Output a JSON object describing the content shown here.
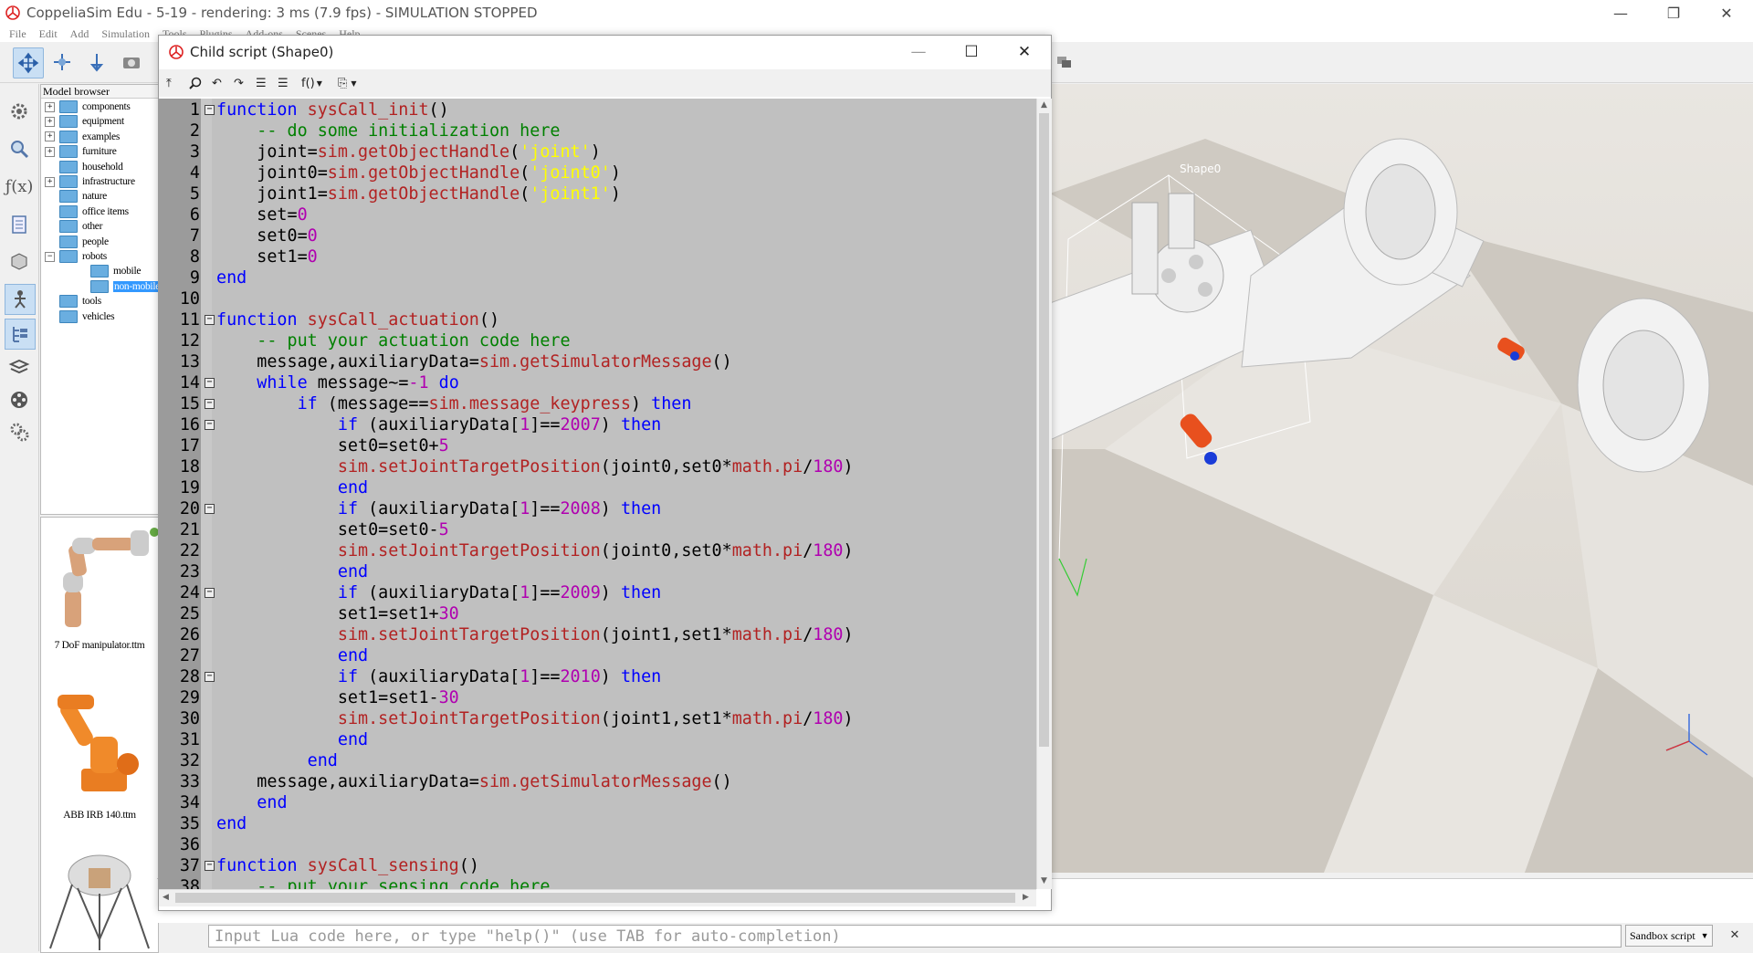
{
  "app": {
    "title": "CoppeliaSim Edu - 5-19 - rendering: 3 ms (7.9 fps) - SIMULATION STOPPED",
    "window_buttons": [
      "—",
      "❐",
      "✕"
    ]
  },
  "menubar": [
    "File",
    "Edit",
    "Add",
    "Simulation",
    "Tools",
    "Plugins",
    "Add-ons",
    "Scenes",
    "Help"
  ],
  "model_browser": {
    "title": "Model browser",
    "items": [
      {
        "label": "components",
        "expand": "+"
      },
      {
        "label": "equipment",
        "expand": "+"
      },
      {
        "label": "examples",
        "expand": "+"
      },
      {
        "label": "furniture",
        "expand": "+"
      },
      {
        "label": "household",
        "expand": ""
      },
      {
        "label": "infrastructure",
        "expand": "+"
      },
      {
        "label": "nature",
        "expand": ""
      },
      {
        "label": "office items",
        "expand": ""
      },
      {
        "label": "other",
        "expand": ""
      },
      {
        "label": "people",
        "expand": ""
      },
      {
        "label": "robots",
        "expand": "−"
      },
      {
        "label": "mobile",
        "expand": ""
      },
      {
        "label": "non-mobile",
        "expand": ""
      },
      {
        "label": "tools",
        "expand": ""
      },
      {
        "label": "vehicles",
        "expand": ""
      }
    ],
    "thumbnails": [
      "7 DoF manipulator.ttm",
      "ABB IRB 140.ttm"
    ]
  },
  "scene": {
    "object_label": "Shape0",
    "colors": {
      "floor_light": "#e8e5e0",
      "floor_dark": "#cbc6be",
      "actuator": "#e8501e",
      "actuator_tip": "#1a3cd8"
    }
  },
  "editor": {
    "title": "Child script (Shape0)",
    "toolbar_func": "f()",
    "lines": [
      {
        "n": "1",
        "fold": "−",
        "t": [
          [
            "kw",
            "function"
          ],
          [
            "pu",
            " "
          ],
          [
            "fn",
            "sysCall_init"
          ],
          [
            "pu",
            "()"
          ]
        ]
      },
      {
        "n": "2",
        "fold": "",
        "t": [
          [
            "pu",
            "    "
          ],
          [
            "cm",
            "-- do some initialization here"
          ]
        ]
      },
      {
        "n": "3",
        "fold": "",
        "t": [
          [
            "pu",
            "    joint="
          ],
          [
            "fn",
            "sim.getObjectHandle"
          ],
          [
            "pu",
            "("
          ],
          [
            "st",
            "'joint'"
          ],
          [
            "pu",
            ")"
          ]
        ]
      },
      {
        "n": "4",
        "fold": "",
        "t": [
          [
            "pu",
            "    joint0="
          ],
          [
            "fn",
            "sim.getObjectHandle"
          ],
          [
            "pu",
            "("
          ],
          [
            "st",
            "'joint0'"
          ],
          [
            "pu",
            ")"
          ]
        ]
      },
      {
        "n": "5",
        "fold": "",
        "t": [
          [
            "pu",
            "    joint1="
          ],
          [
            "fn",
            "sim.getObjectHandle"
          ],
          [
            "pu",
            "("
          ],
          [
            "st",
            "'joint1'"
          ],
          [
            "pu",
            ")"
          ]
        ]
      },
      {
        "n": "6",
        "fold": "",
        "t": [
          [
            "pu",
            "    set="
          ],
          [
            "nm",
            "0"
          ]
        ]
      },
      {
        "n": "7",
        "fold": "",
        "t": [
          [
            "pu",
            "    set0="
          ],
          [
            "nm",
            "0"
          ]
        ]
      },
      {
        "n": "8",
        "fold": "",
        "t": [
          [
            "pu",
            "    set1="
          ],
          [
            "nm",
            "0"
          ]
        ]
      },
      {
        "n": "9",
        "fold": "",
        "t": [
          [
            "kw",
            "end"
          ]
        ]
      },
      {
        "n": "10",
        "fold": "",
        "t": []
      },
      {
        "n": "11",
        "fold": "−",
        "t": [
          [
            "kw",
            "function"
          ],
          [
            "pu",
            " "
          ],
          [
            "fn",
            "sysCall_actuation"
          ],
          [
            "pu",
            "()"
          ]
        ]
      },
      {
        "n": "12",
        "fold": "",
        "t": [
          [
            "pu",
            "    "
          ],
          [
            "cm",
            "-- put your actuation code here"
          ]
        ]
      },
      {
        "n": "13",
        "fold": "",
        "t": [
          [
            "pu",
            "    message,auxiliaryData="
          ],
          [
            "fn",
            "sim.getSimulatorMessage"
          ],
          [
            "pu",
            "()"
          ]
        ]
      },
      {
        "n": "14",
        "fold": "−",
        "t": [
          [
            "pu",
            "    "
          ],
          [
            "kw",
            "while"
          ],
          [
            "pu",
            " message~="
          ],
          [
            "nm",
            "-1"
          ],
          [
            "pu",
            " "
          ],
          [
            "kw",
            "do"
          ]
        ]
      },
      {
        "n": "15",
        "fold": "−",
        "t": [
          [
            "pu",
            "        "
          ],
          [
            "kw",
            "if"
          ],
          [
            "pu",
            " (message=="
          ],
          [
            "fn",
            "sim.message_keypress"
          ],
          [
            "pu",
            ") "
          ],
          [
            "kw",
            "then"
          ]
        ]
      },
      {
        "n": "16",
        "fold": "−",
        "t": [
          [
            "pu",
            "            "
          ],
          [
            "kw",
            "if"
          ],
          [
            "pu",
            " (auxiliaryData["
          ],
          [
            "nm",
            "1"
          ],
          [
            "pu",
            "]=="
          ],
          [
            "nm",
            "2007"
          ],
          [
            "pu",
            ") "
          ],
          [
            "kw",
            "then"
          ]
        ]
      },
      {
        "n": "17",
        "fold": "",
        "t": [
          [
            "pu",
            "            set0=set0+"
          ],
          [
            "nm",
            "5"
          ]
        ]
      },
      {
        "n": "18",
        "fold": "",
        "t": [
          [
            "pu",
            "            "
          ],
          [
            "fn",
            "sim.setJointTargetPosition"
          ],
          [
            "pu",
            "(joint0,set0*"
          ],
          [
            "fn",
            "math.pi"
          ],
          [
            "pu",
            "/"
          ],
          [
            "nm",
            "180"
          ],
          [
            "pu",
            ")"
          ]
        ]
      },
      {
        "n": "19",
        "fold": "",
        "t": [
          [
            "pu",
            "            "
          ],
          [
            "kw",
            "end"
          ]
        ]
      },
      {
        "n": "20",
        "fold": "−",
        "t": [
          [
            "pu",
            "            "
          ],
          [
            "kw",
            "if"
          ],
          [
            "pu",
            " (auxiliaryData["
          ],
          [
            "nm",
            "1"
          ],
          [
            "pu",
            "]=="
          ],
          [
            "nm",
            "2008"
          ],
          [
            "pu",
            ") "
          ],
          [
            "kw",
            "then"
          ]
        ]
      },
      {
        "n": "21",
        "fold": "",
        "t": [
          [
            "pu",
            "            set0=set0-"
          ],
          [
            "nm",
            "5"
          ]
        ]
      },
      {
        "n": "22",
        "fold": "",
        "t": [
          [
            "pu",
            "            "
          ],
          [
            "fn",
            "sim.setJointTargetPosition"
          ],
          [
            "pu",
            "(joint0,set0*"
          ],
          [
            "fn",
            "math.pi"
          ],
          [
            "pu",
            "/"
          ],
          [
            "nm",
            "180"
          ],
          [
            "pu",
            ")"
          ]
        ]
      },
      {
        "n": "23",
        "fold": "",
        "t": [
          [
            "pu",
            "            "
          ],
          [
            "kw",
            "end"
          ]
        ]
      },
      {
        "n": "24",
        "fold": "−",
        "t": [
          [
            "pu",
            "            "
          ],
          [
            "kw",
            "if"
          ],
          [
            "pu",
            " (auxiliaryData["
          ],
          [
            "nm",
            "1"
          ],
          [
            "pu",
            "]=="
          ],
          [
            "nm",
            "2009"
          ],
          [
            "pu",
            ") "
          ],
          [
            "kw",
            "then"
          ]
        ]
      },
      {
        "n": "25",
        "fold": "",
        "t": [
          [
            "pu",
            "            set1=set1+"
          ],
          [
            "nm",
            "30"
          ]
        ]
      },
      {
        "n": "26",
        "fold": "",
        "t": [
          [
            "pu",
            "            "
          ],
          [
            "fn",
            "sim.setJointTargetPosition"
          ],
          [
            "pu",
            "(joint1,set1*"
          ],
          [
            "fn",
            "math.pi"
          ],
          [
            "pu",
            "/"
          ],
          [
            "nm",
            "180"
          ],
          [
            "pu",
            ")"
          ]
        ]
      },
      {
        "n": "27",
        "fold": "",
        "t": [
          [
            "pu",
            "            "
          ],
          [
            "kw",
            "end"
          ]
        ]
      },
      {
        "n": "28",
        "fold": "−",
        "t": [
          [
            "pu",
            "            "
          ],
          [
            "kw",
            "if"
          ],
          [
            "pu",
            " (auxiliaryData["
          ],
          [
            "nm",
            "1"
          ],
          [
            "pu",
            "]=="
          ],
          [
            "nm",
            "2010"
          ],
          [
            "pu",
            ") "
          ],
          [
            "kw",
            "then"
          ]
        ]
      },
      {
        "n": "29",
        "fold": "",
        "t": [
          [
            "pu",
            "            set1=set1-"
          ],
          [
            "nm",
            "30"
          ]
        ]
      },
      {
        "n": "30",
        "fold": "",
        "t": [
          [
            "pu",
            "            "
          ],
          [
            "fn",
            "sim.setJointTargetPosition"
          ],
          [
            "pu",
            "(joint1,set1*"
          ],
          [
            "fn",
            "math.pi"
          ],
          [
            "pu",
            "/"
          ],
          [
            "nm",
            "180"
          ],
          [
            "pu",
            ")"
          ]
        ]
      },
      {
        "n": "31",
        "fold": "",
        "t": [
          [
            "pu",
            "            "
          ],
          [
            "kw",
            "end"
          ]
        ]
      },
      {
        "n": "32",
        "fold": "",
        "t": [
          [
            "pu",
            "         "
          ],
          [
            "kw",
            "end"
          ]
        ]
      },
      {
        "n": "33",
        "fold": "",
        "t": [
          [
            "pu",
            "    message,auxiliaryData="
          ],
          [
            "fn",
            "sim.getSimulatorMessage"
          ],
          [
            "pu",
            "()"
          ]
        ]
      },
      {
        "n": "34",
        "fold": "",
        "t": [
          [
            "pu",
            "    "
          ],
          [
            "kw",
            "end"
          ]
        ]
      },
      {
        "n": "35",
        "fold": "",
        "t": [
          [
            "kw",
            "end"
          ]
        ]
      },
      {
        "n": "36",
        "fold": "",
        "t": []
      },
      {
        "n": "37",
        "fold": "−",
        "t": [
          [
            "kw",
            "function"
          ],
          [
            "pu",
            " "
          ],
          [
            "fn",
            "sysCall_sensing"
          ],
          [
            "pu",
            "()"
          ]
        ]
      },
      {
        "n": "38",
        "fold": "",
        "t": [
          [
            "pu",
            "    "
          ],
          [
            "cm",
            "-- put your sensing code here"
          ]
        ]
      }
    ]
  },
  "console": {
    "placeholder": "Input Lua code here, or type \"help()\" (use TAB for auto-completion)",
    "sandbox_label": "Sandbox script",
    "close": "✕"
  }
}
